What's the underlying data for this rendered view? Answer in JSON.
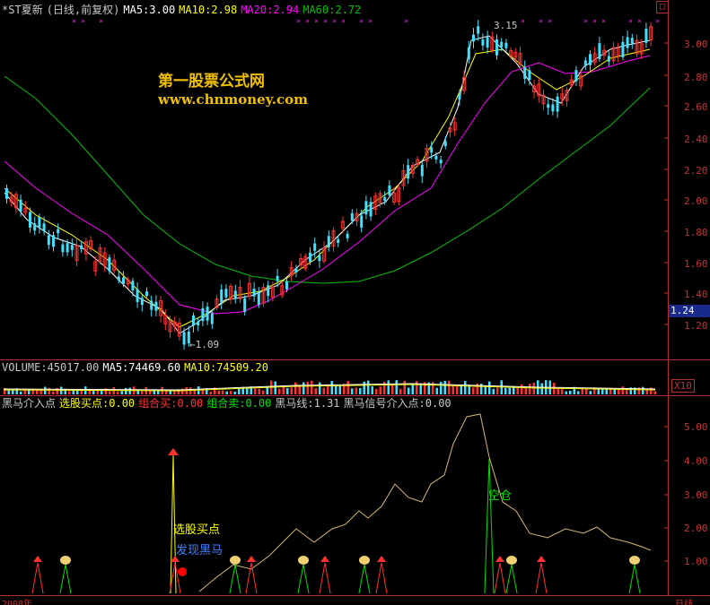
{
  "price_header": {
    "title": "*ST夏新",
    "period": "(日线,前复权)",
    "ma5": "MA5:3.00",
    "ma10": "MA10:2.98",
    "ma20": "MA20:2.94",
    "ma60": "MA60:2.72"
  },
  "watermark": {
    "name": "第一股票公式网",
    "url": "www.chnmoney.com"
  },
  "annotations": {
    "high": "3.15",
    "low": "1.09",
    "current_price": "1.24"
  },
  "price_axis": [
    "3.00",
    "2.80",
    "2.60",
    "2.40",
    "2.20",
    "2.00",
    "1.80",
    "1.60",
    "1.40",
    "1.20"
  ],
  "volume_header": {
    "label": "VOLUME:45017.00",
    "ma5": "MA5:74469.60",
    "ma10": "MA10:74509.20",
    "scale": "X10"
  },
  "indicator_header": {
    "name": "黑马介入点",
    "buy_point": "选股买点:0.00",
    "combo_buy": "组合买:0.00",
    "combo_sell": "组合卖:0.00",
    "black_horse": "黑马线:1.31",
    "signal": "黑马信号介入点:0.00"
  },
  "indicator_axis": [
    "5.00",
    "4.00",
    "3.00",
    "2.00",
    "1.00"
  ],
  "indicator_labels": {
    "buy": "选股买点",
    "found": "发现黑马",
    "empty": "空仓"
  },
  "bottom_axis": {
    "left": "2008年",
    "right": "日线"
  },
  "colors": {
    "ma5": "#ffffff",
    "ma10": "#ffff00",
    "ma20": "#ff00ff",
    "ma60": "#00c000",
    "up": "#ff3030",
    "down": "#40e0ff",
    "axis": "#c83232"
  },
  "chart_data": [
    {
      "type": "line",
      "title": "*ST夏新",
      "series": [
        {
          "name": "MA5",
          "values": [
            3.0
          ]
        },
        {
          "name": "MA10",
          "values": [
            2.98
          ]
        },
        {
          "name": "MA20",
          "values": [
            2.94
          ]
        },
        {
          "name": "MA60",
          "values": [
            2.72
          ]
        }
      ],
      "ylim": [
        1.1,
        3.2
      ]
    },
    {
      "type": "line",
      "title": "黑马介入点",
      "series": [
        {
          "name": "黑马线",
          "values": [
            1.31
          ]
        }
      ],
      "ylim": [
        0,
        5.7
      ]
    }
  ]
}
